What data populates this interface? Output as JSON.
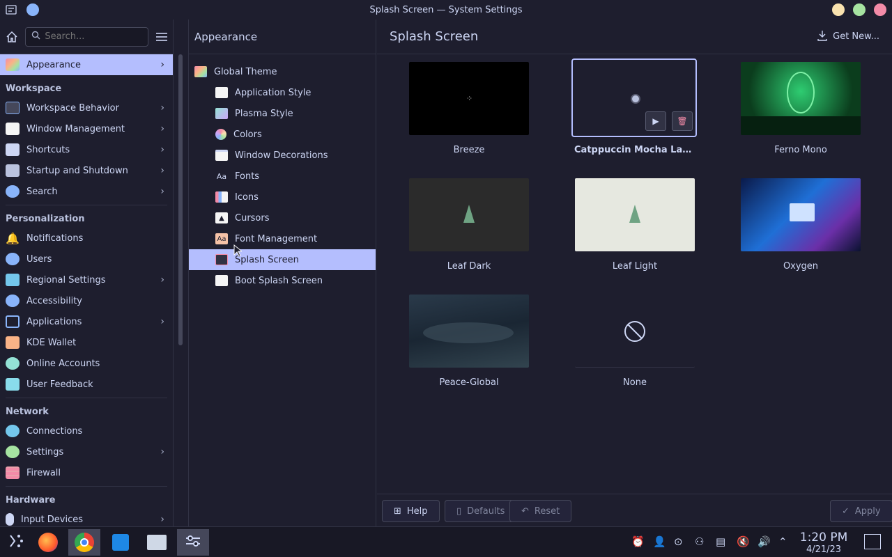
{
  "window": {
    "title": "Splash Screen — System Settings"
  },
  "sidebar": {
    "search_placeholder": "Search...",
    "active": {
      "label": "Appearance"
    },
    "sections": [
      {
        "heading": "Workspace",
        "items": [
          "Workspace Behavior",
          "Window Management",
          "Shortcuts",
          "Startup and Shutdown",
          "Search"
        ]
      },
      {
        "heading": "Personalization",
        "items": [
          "Notifications",
          "Users",
          "Regional Settings",
          "Accessibility",
          "Applications",
          "KDE Wallet",
          "Online Accounts",
          "User Feedback"
        ]
      },
      {
        "heading": "Network",
        "items": [
          "Connections",
          "Settings",
          "Firewall"
        ]
      },
      {
        "heading": "Hardware",
        "items": [
          "Input Devices"
        ]
      }
    ]
  },
  "middle": {
    "title": "Appearance",
    "root": "Global Theme",
    "items": [
      "Application Style",
      "Plasma Style",
      "Colors",
      "Window Decorations",
      "Fonts",
      "Icons",
      "Cursors",
      "Font Management",
      "Splash Screen",
      "Boot Splash Screen"
    ]
  },
  "main": {
    "title": "Splash Screen",
    "get_new": "Get New...",
    "themes": [
      "Breeze",
      "Catppuccin Mocha Laven...",
      "Ferno Mono",
      "Leaf Dark",
      "Leaf Light",
      "Oxygen",
      "Peace-Global",
      "None"
    ]
  },
  "footer": {
    "help": "Help",
    "defaults": "Defaults",
    "reset": "Reset",
    "apply": "Apply"
  },
  "taskbar": {
    "time": "1:20 PM",
    "date": "4/21/23"
  },
  "colors": {
    "accent": "#b4befe",
    "base": "#1e1e2e",
    "text": "#cdd6f4"
  }
}
